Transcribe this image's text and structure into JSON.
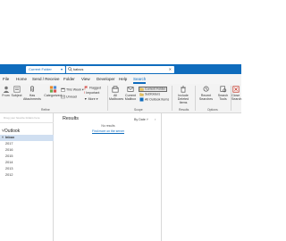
{
  "search": {
    "scope_label": "Current Folder",
    "query": "kalcus"
  },
  "menu": [
    "File",
    "Home",
    "Send / Receive",
    "Folder",
    "View",
    "Developer",
    "Help",
    "Search"
  ],
  "ribbon": {
    "from": "From",
    "subject": "Subject",
    "has_attachments": "Has Attachments",
    "categorized": "Categorized",
    "this_week": "This Week",
    "unread": "Unread",
    "flagged": "Flagged",
    "important": "Important",
    "more": "More",
    "refine_group": "Refine",
    "all_mailboxes": "All Mailboxes",
    "current_mailbox": "Current Mailbox",
    "current_folder": "Current Folder",
    "subfolders": "Subfolders",
    "all_outlook_items": "All Outlook Items",
    "scope_group": "Scope",
    "include_older": "Include Deleted Items",
    "results_group": "Results",
    "recent_searches": "Recent Searches",
    "search_tools": "Search Tools",
    "options_group": "Options",
    "close_search": "Close Search"
  },
  "leftpane": {
    "drag_tip": "Drag your favorite folders here",
    "account": "Outlook",
    "folders": [
      "Inbox",
      "2017",
      "2016",
      "2015",
      "2014",
      "2013",
      "2012"
    ]
  },
  "results": {
    "title": "Results",
    "sort": "By Date",
    "no_results": "No results",
    "link": "Find more on the server"
  },
  "colors": {
    "accent": "#0f6cbd"
  }
}
